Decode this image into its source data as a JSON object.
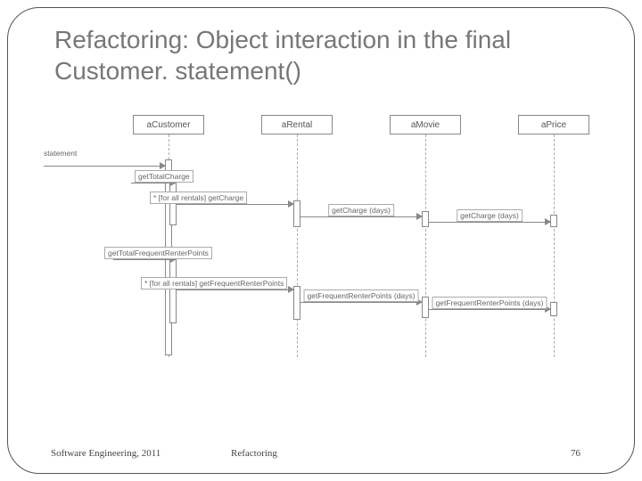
{
  "title": "Refactoring: Object interaction in the final Customer. statement()",
  "footer": {
    "left": "Software Engineering, 2011",
    "center": "Refactoring",
    "right": "76"
  },
  "diagram": {
    "objects": [
      "aCustomer",
      "aRental",
      "aMovie",
      "aPrice"
    ],
    "entry": "statement",
    "messages": {
      "m1": "getTotalCharge",
      "m2": "* [for all rentals] getCharge",
      "m3": "getCharge (days)",
      "m4": "getCharge (days)",
      "m5": "getTotalFrequentRenterPoints",
      "m6": "* [for all rentals] getFrequentRenterPoints",
      "m7": "getFrequentRenterPoints (days)",
      "m8": "getFrequentRenterPoints (days)"
    }
  }
}
